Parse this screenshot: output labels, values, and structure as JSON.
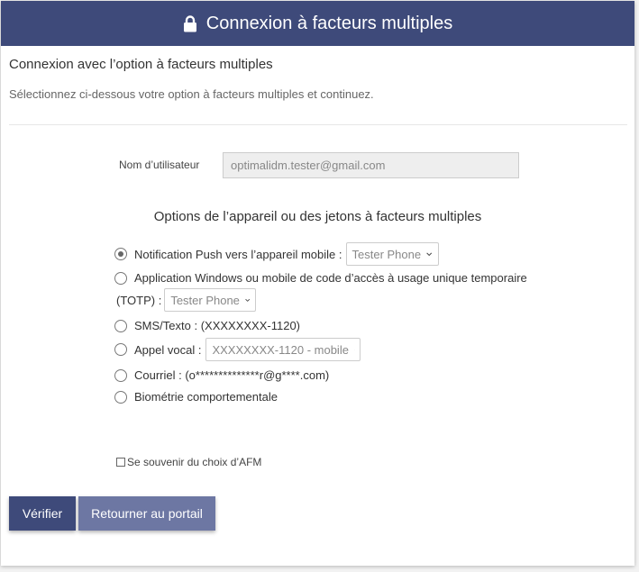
{
  "header": {
    "title": "Connexion à facteurs multiples",
    "icon": "lock-icon"
  },
  "subtitle": "Connexion avec l’option à facteurs multiples",
  "instructions": "Sélectionnez ci-dessous votre option à facteurs multiples et continuez.",
  "username": {
    "label": "Nom d’utilisateur",
    "value": "optimalidm.tester@gmail.com"
  },
  "options_heading": "Options de l’appareil ou des jetons à facteurs multiples",
  "options": {
    "push": {
      "label": "Notification Push vers l’appareil mobile :",
      "device": "Tester Phone",
      "selected": true
    },
    "totp": {
      "label_line1": "Application Windows ou mobile de code d’accès à usage unique temporaire",
      "label_line2": "(TOTP) :",
      "device": "Tester Phone",
      "selected": false
    },
    "sms": {
      "label": "SMS/Texto : (XXXXXXXX-1120)",
      "selected": false
    },
    "voice": {
      "label": "Appel vocal :",
      "device": "XXXXXXXX-1120 - mobile",
      "selected": false
    },
    "email": {
      "label": "Courriel : (o**************r@g****.com)",
      "selected": false
    },
    "biometric": {
      "label": "Biométrie comportementale",
      "selected": false
    }
  },
  "remember": {
    "label": "Se souvenir du choix d’AFM",
    "checked": false
  },
  "buttons": {
    "verify": "Vérifier",
    "portal": "Retourner au portail"
  },
  "colors": {
    "primary": "#3e4a7a",
    "secondary": "#6d77a3"
  }
}
